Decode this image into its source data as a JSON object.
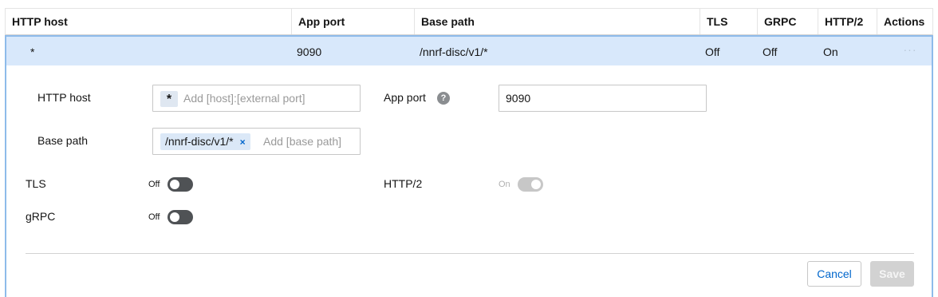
{
  "table": {
    "headers": {
      "http_host": "HTTP host",
      "app_port": "App port",
      "base_path": "Base path",
      "tls": "TLS",
      "grpc": "GRPC",
      "http2": "HTTP/2",
      "actions": "Actions"
    },
    "row": {
      "http_host": "*",
      "app_port": "9090",
      "base_path": "/nnrf-disc/v1/*",
      "tls": "Off",
      "grpc": "Off",
      "http2": "On",
      "actions_icon": "kebab-icon",
      "actions_glyph": "···"
    }
  },
  "form": {
    "http_host": {
      "label": "HTTP host",
      "chip": "*",
      "placeholder": "Add [host]:[external port]"
    },
    "app_port": {
      "label": "App port",
      "help_glyph": "?",
      "value": "9090"
    },
    "base_path": {
      "label": "Base path",
      "chip": "/nnrf-disc/v1/*",
      "chip_remove": "×",
      "placeholder": "Add [base path]"
    },
    "tls": {
      "label": "TLS",
      "state": "Off",
      "enabled": false
    },
    "http2": {
      "label": "HTTP/2",
      "state": "On",
      "enabled": true,
      "disabled": true
    },
    "grpc": {
      "label": "gRPC",
      "state": "Off",
      "enabled": false
    }
  },
  "buttons": {
    "cancel": "Cancel",
    "save": "Save"
  },
  "colors": {
    "selected_row_bg": "#d8e8fb",
    "selected_border": "#8ebbea",
    "link_blue": "#0066cc",
    "switch_off": "#4f5255",
    "switch_disabled": "#c7c7c7"
  }
}
